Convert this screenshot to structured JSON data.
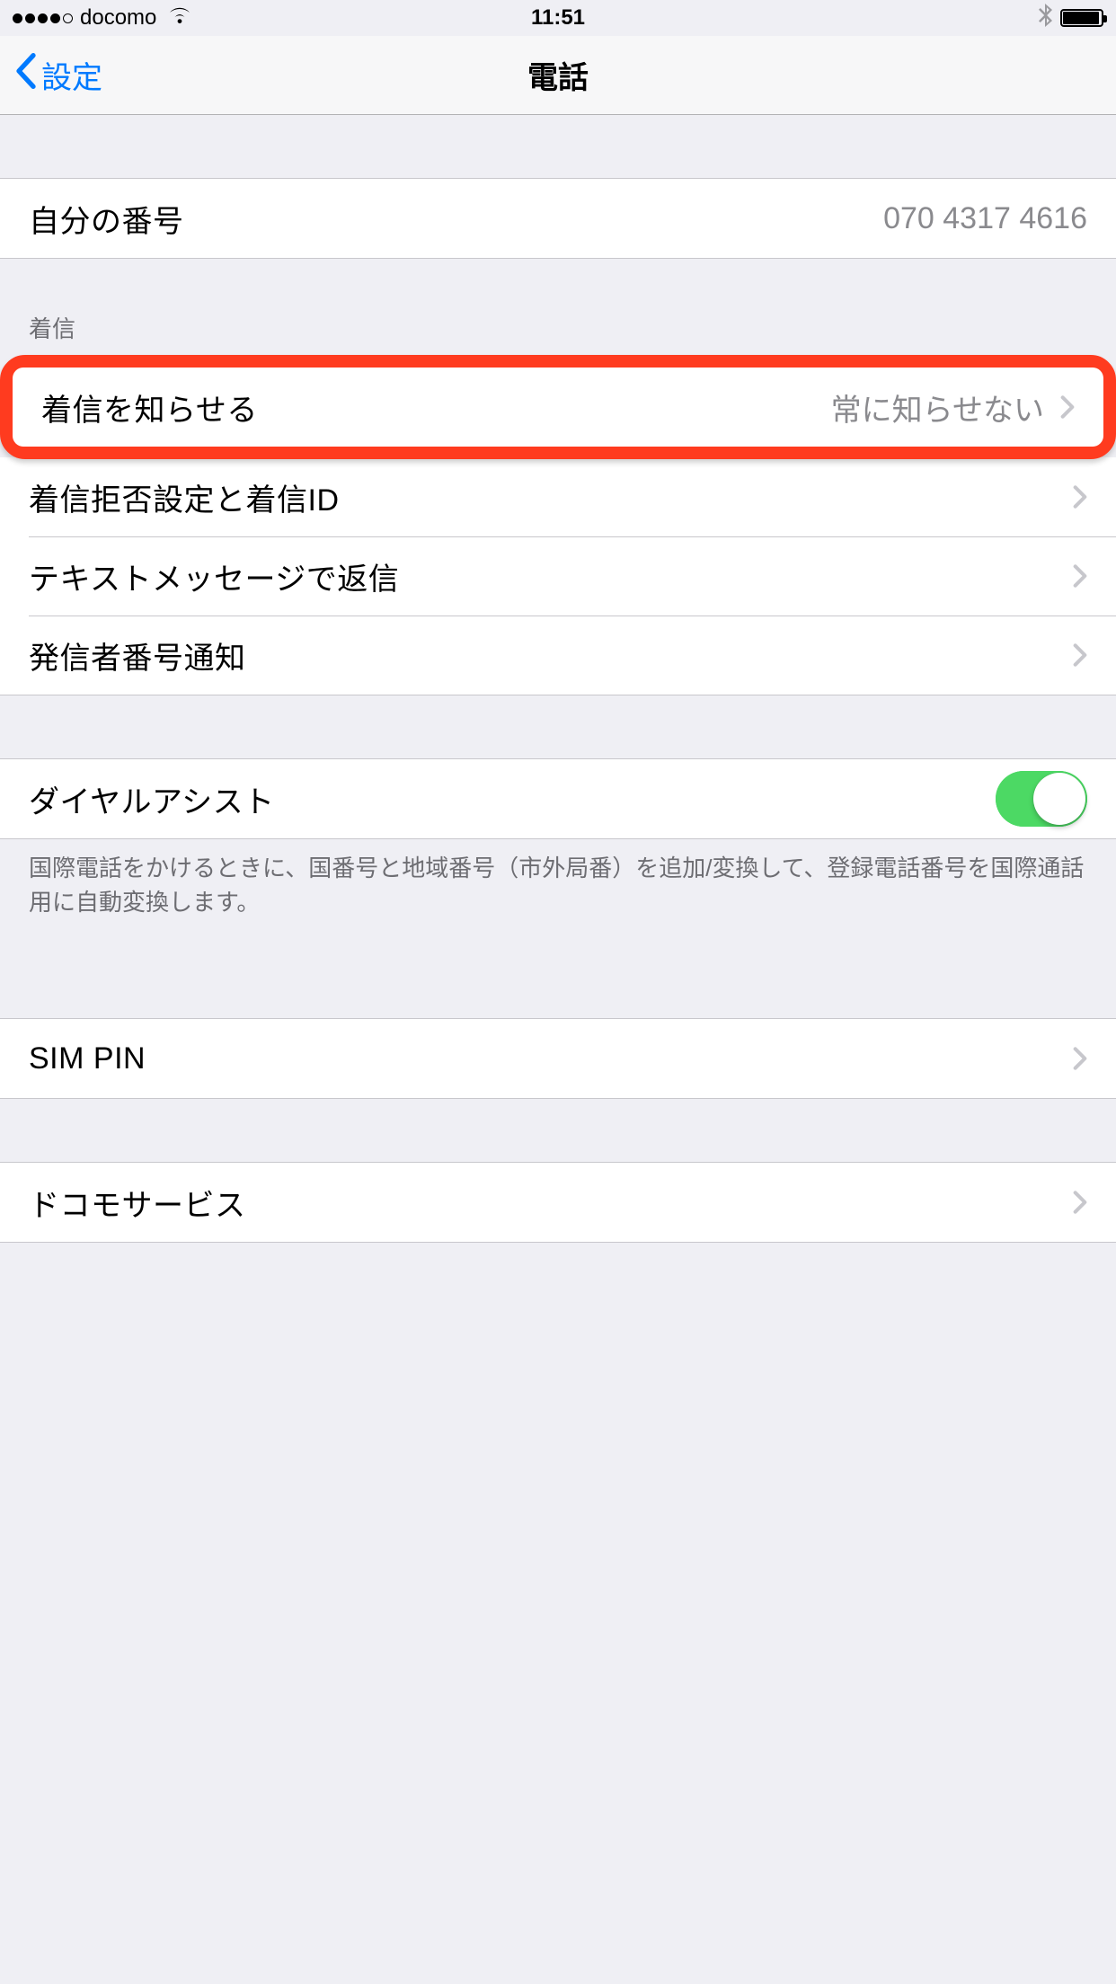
{
  "status": {
    "carrier": "docomo",
    "time": "11:51"
  },
  "nav": {
    "back_label": "設定",
    "title": "電話"
  },
  "my_number": {
    "label": "自分の番号",
    "value": "070 4317 4616"
  },
  "incoming": {
    "header": "着信",
    "announce": {
      "label": "着信を知らせる",
      "value": "常に知らせない"
    },
    "block": {
      "label": "着信拒否設定と着信ID"
    },
    "text_reply": {
      "label": "テキストメッセージで返信"
    },
    "caller_id": {
      "label": "発信者番号通知"
    }
  },
  "dial_assist": {
    "label": "ダイヤルアシスト",
    "note": "国際電話をかけるときに、国番号と地域番号（市外局番）を追加/変換して、登録電話番号を国際通話用に自動変換します。",
    "on": true
  },
  "sim_pin": {
    "label": "SIM PIN"
  },
  "docomo": {
    "label": "ドコモサービス"
  }
}
